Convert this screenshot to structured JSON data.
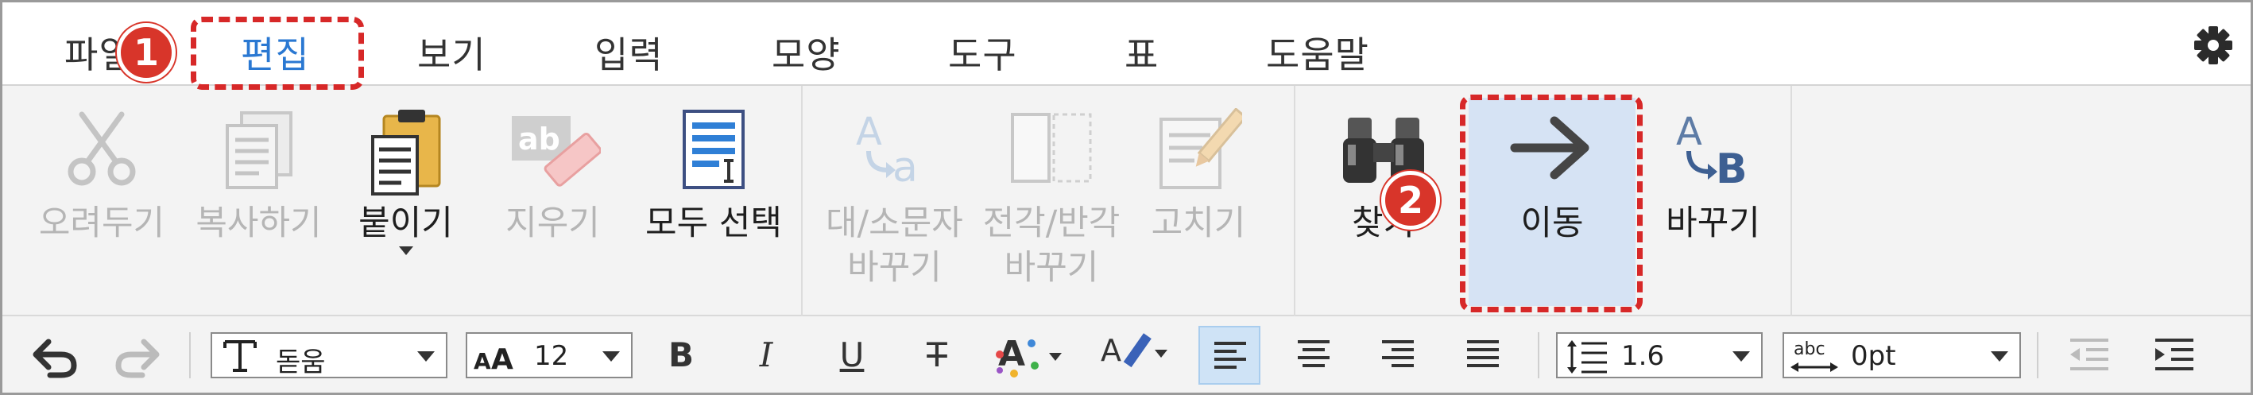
{
  "menu": {
    "tabs": [
      {
        "label": "파일"
      },
      {
        "label": "편집"
      },
      {
        "label": "보기"
      },
      {
        "label": "입력"
      },
      {
        "label": "모양"
      },
      {
        "label": "도구"
      },
      {
        "label": "표"
      },
      {
        "label": "도움말"
      }
    ],
    "active_tab": "편집"
  },
  "ribbon": {
    "cut": "오려두기",
    "copy": "복사하기",
    "paste": "붙이기",
    "erase": "지우기",
    "select_all": "모두 선택",
    "case_line1": "대/소문자",
    "case_line2": "바꾸기",
    "width_line1": "전각/반각",
    "width_line2": "바꾸기",
    "correct": "고치기",
    "find": "찾기",
    "goto": "이동",
    "replace": "바꾸기"
  },
  "toolbar": {
    "font": "돋움",
    "font_size": "12",
    "line_spacing": "1.6",
    "char_spacing": "0pt",
    "bold": "B",
    "italic": "I",
    "underline": "U",
    "strike": "T"
  },
  "callouts": {
    "one": "1",
    "two": "2"
  },
  "colors": {
    "accent": "#2a78d2",
    "callout": "#d8352a",
    "highlight": "#d6e3f4"
  }
}
